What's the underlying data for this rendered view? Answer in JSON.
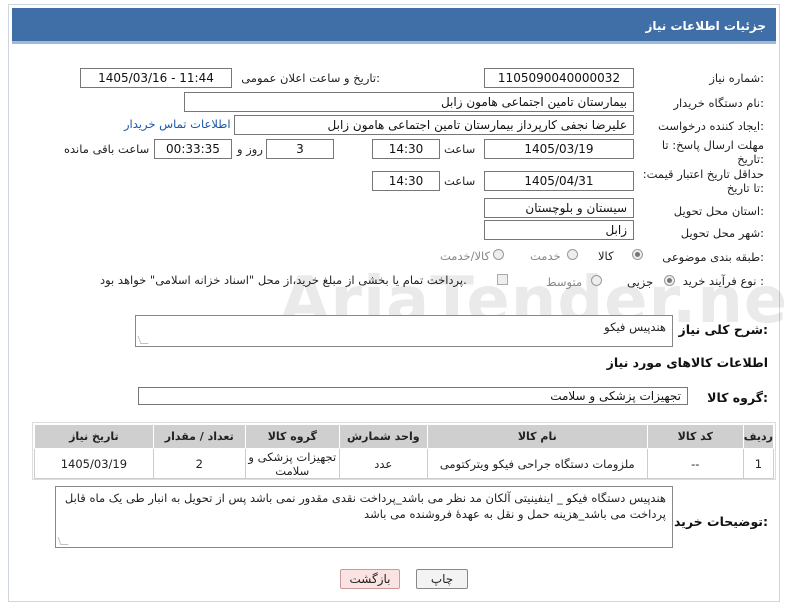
{
  "header": {
    "title": "جزئیات اطلاعات نیاز"
  },
  "fields": {
    "need_number_label": "شماره نیاز:",
    "need_number": "1105090040000032",
    "announce_label": "تاریخ و ساعت اعلان عمومی:",
    "announce_value": "1405/03/16 - 11:44",
    "buyer_label": "نام دستگاه خریدار:",
    "buyer_value": "بیمارستان تامین اجتماعی هامون  زابل",
    "creator_label": "ایجاد کننده درخواست:",
    "creator_value": "علیرضا نجفی کارپرداز بیمارستان تامین اجتماعی هامون  زابل",
    "contact_link": "اطلاعات تماس خریدار",
    "deadline_label": "مهلت ارسال پاسخ: تا تاریخ:",
    "deadline_date": "1405/03/19",
    "time_label": "ساعت",
    "deadline_time": "14:30",
    "days_value": "3",
    "days_label": "روز و",
    "remaining_time": "00:33:35",
    "remaining_label": "ساعت باقی مانده",
    "validity_label": "حداقل تاریخ اعتبار قیمت: تا تاریخ:",
    "validity_date": "1405/04/31",
    "validity_time": "14:30",
    "province_label": "استان محل تحویل:",
    "province_value": "سیستان و بلوچستان",
    "city_label": "شهر محل تحویل:",
    "city_value": "زابل",
    "category_label": "طبقه بندی موضوعی:",
    "category_goods": "کالا",
    "category_service": "خدمت",
    "category_both": "کالا/خدمت",
    "process_label": "نوع فرآیند خرید :",
    "process_minor": "جزیی",
    "process_medium": "متوسط",
    "payment_note": "پرداخت تمام یا بخشی از مبلغ خرید،از محل \"اسناد خزانه اسلامی\" خواهد بود."
  },
  "description": {
    "label": "شرح کلی نیاز:",
    "value": "هندپیس فیکو"
  },
  "goods": {
    "section_title": "اطلاعات کالاهای مورد نیاز",
    "group_label": "گروه کالا:",
    "group_value": "تجهیزات پزشکی و سلامت",
    "columns": [
      "ردیف",
      "کد کالا",
      "نام کالا",
      "واحد شمارش",
      "گروه کالا",
      "تعداد / مقدار",
      "تاریخ نیاز"
    ],
    "rows": [
      [
        "1",
        "--",
        "ملزومات دستگاه جراحی فیکو ویترکتومی",
        "عدد",
        "تجهیزات پزشکی و سلامت",
        "2",
        "1405/03/19"
      ]
    ]
  },
  "buyer_notes": {
    "label": "توضیحات خریدار:",
    "value": "هندپیس دستگاه فیکو _ اینفینیتی آلکان مد نظر می باشد_پرداخت نقدی مقدور نمی باشد پس از تحویل به انبار طی یک ماه قابل پرداخت می باشد_هزینه حمل و نقل به عهدۀ فروشنده می باشد"
  },
  "buttons": {
    "print": "چاپ",
    "back": "بازگشت"
  },
  "watermark": {
    "text": "AriaTender.neT"
  },
  "colors": {
    "header": "#3f6fa6",
    "back_button": "#fbe3e3",
    "print_button": "#f3f3f3",
    "link": "#1a57a8"
  }
}
